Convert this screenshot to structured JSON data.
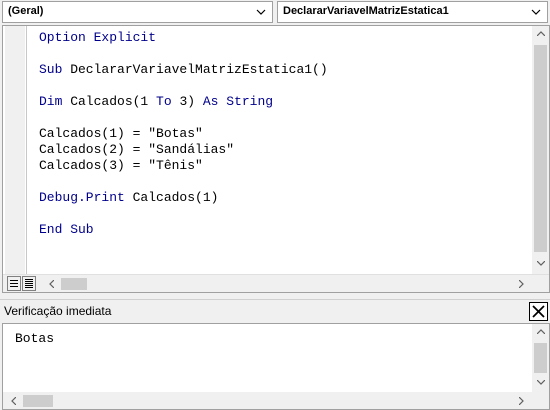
{
  "object_combo": {
    "value": "(Geral)",
    "icon": "chevron-down-icon"
  },
  "procedure_combo": {
    "value": "DeclararVariavelMatrizEstatica1",
    "icon": "chevron-down-icon"
  },
  "code": {
    "lines": [
      {
        "kw": "Option Explicit",
        "rest": ""
      },
      {
        "kw": "",
        "rest": ""
      },
      {
        "kw": "Sub",
        "rest": " DeclararVariavelMatrizEstatica1()"
      },
      {
        "kw": "",
        "rest": ""
      },
      {
        "kw": "Dim",
        "rest": " Calcados(1 ",
        "kw2": "To",
        "rest2": " 3) ",
        "kw3": "As String"
      },
      {
        "kw": "",
        "rest": ""
      },
      {
        "kw": "",
        "rest": "Calcados(1) = \"Botas\""
      },
      {
        "kw": "",
        "rest": "Calcados(2) = \"Sandálias\""
      },
      {
        "kw": "",
        "rest": "Calcados(3) = \"Tênis\""
      },
      {
        "kw": "",
        "rest": ""
      },
      {
        "kw": "Debug.Print",
        "rest": " Calcados(1)"
      },
      {
        "kw": "",
        "rest": ""
      },
      {
        "kw": "End Sub",
        "rest": ""
      }
    ],
    "keyword_color": "#00008b"
  },
  "immediate_window": {
    "title": "Verificação imediata",
    "output": "Botas",
    "close_icon": "close-icon"
  }
}
